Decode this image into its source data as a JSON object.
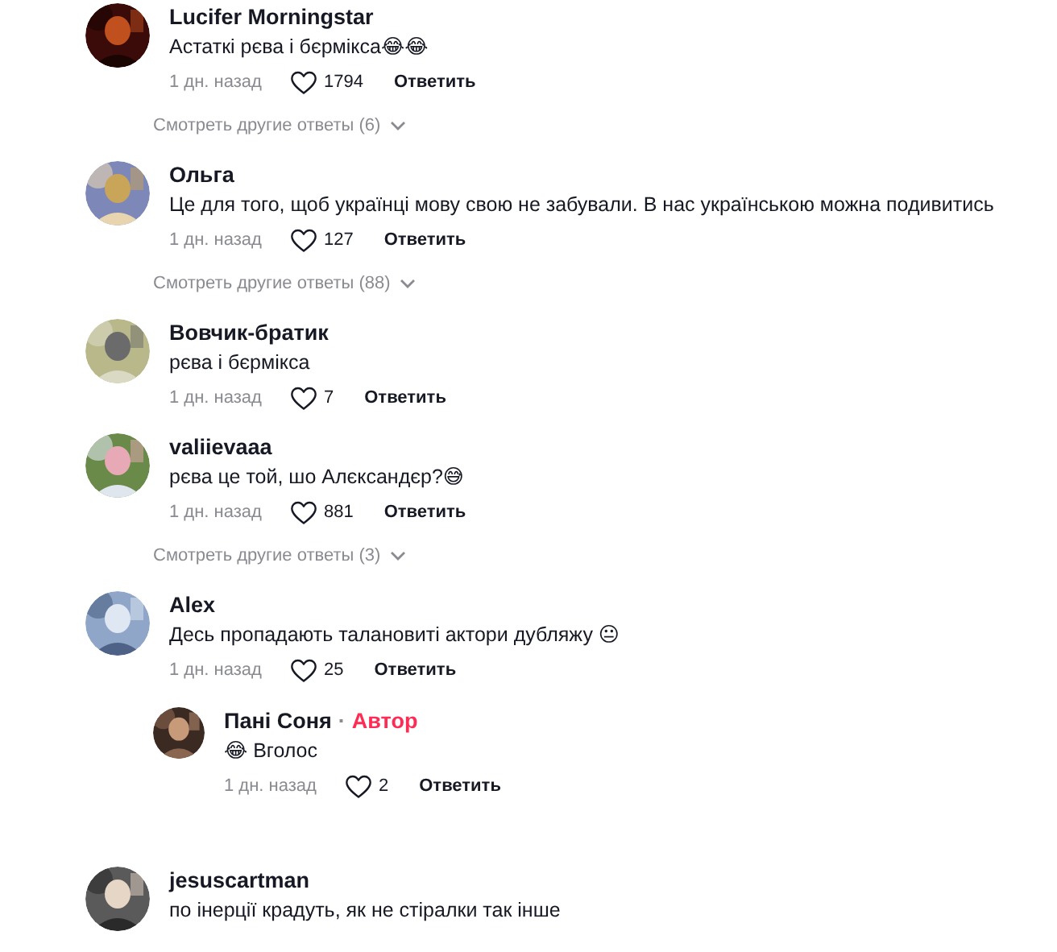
{
  "comments": [
    {
      "author": "Lucifer Morningstar",
      "text": "Астаткі рєва і бєрмікса😂😂",
      "time": "1 дн. назад",
      "likes": "1794",
      "reply_label": "Ответить",
      "more_replies": "Смотреть другие ответы (6)"
    },
    {
      "author": "Ольга",
      "text": "Це для того, щоб українці мову свою не забували. В нас українською можна подивитись",
      "time": "1 дн. назад",
      "likes": "127",
      "reply_label": "Ответить",
      "more_replies": "Смотреть другие ответы (88)"
    },
    {
      "author": "Вовчик-братик",
      "text": "рєва і бєрмікса",
      "time": "1 дн. назад",
      "likes": "7",
      "reply_label": "Ответить"
    },
    {
      "author": "valiievaaa",
      "text": "рєва це той, шо Алєксандєр?😅",
      "time": "1 дн. назад",
      "likes": "881",
      "reply_label": "Ответить",
      "more_replies": "Смотреть другие ответы (3)"
    },
    {
      "author": "Alex",
      "text": "Десь пропадають талановиті актори дубляжу 😐",
      "time": "1 дн. назад",
      "likes": "25",
      "reply_label": "Ответить",
      "replies": [
        {
          "author": "Пані Соня",
          "separator": "·",
          "badge": "Автор",
          "text": "😂 Вголос",
          "time": "1 дн. назад",
          "likes": "2",
          "reply_label": "Ответить"
        }
      ]
    },
    {
      "author": "jesuscartman",
      "text": "по інерції крадуть, як не стіралки так інше"
    }
  ]
}
